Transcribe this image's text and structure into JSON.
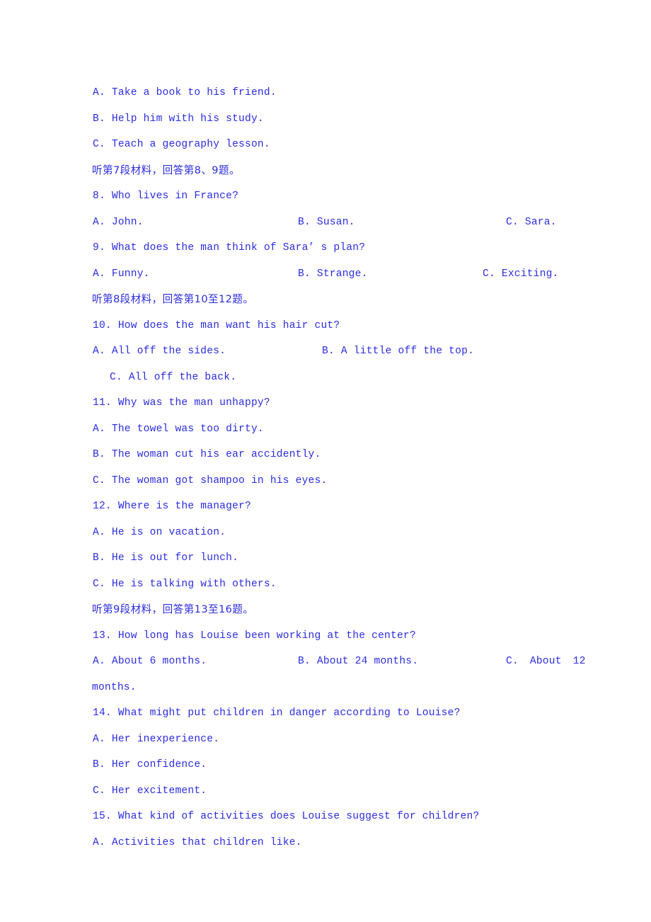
{
  "document": {
    "language_mix": "english-chinese",
    "text_color": "#2b2be0",
    "background_color": "#ffffff"
  },
  "lines": {
    "q7_opt_a": "A. Take a book to his friend.",
    "q7_opt_b": "B. Help him with his study.",
    "q7_opt_c": "C. Teach a geography lesson.",
    "section7_header": "听第7段材料，回答第8、9题。",
    "q8_stem": "8. Who lives in France?",
    "q8_a": "A. John.",
    "q8_b": "B. Susan.",
    "q8_c": "C. Sara.",
    "q9_stem": "9. What does the man think of Sara’ s plan?",
    "q9_a": "A. Funny.",
    "q9_b": "B. Strange.",
    "q9_c": "C. Exciting.",
    "section8_header": "听第8段材料，回答第10至12题。",
    "q10_stem": "10. How does the man want his hair cut?",
    "q10_a": "A. All off the sides.",
    "q10_b": "B. A little off the top.",
    "q10_c": "C. All off the back.",
    "q11_stem": "11. Why was the man unhappy?",
    "q11_a": "A. The towel was too dirty.",
    "q11_b": "B. The woman cut his ear accidently.",
    "q11_c": "C. The woman got shampoo in his eyes.",
    "q12_stem": "12. Where is the manager?",
    "q12_a": "A. He is on vacation.",
    "q12_b": "B. He is out for lunch.",
    "q12_c": "C. He is talking with others.",
    "section9_header": "听第9段材料，回答第13至16题。",
    "q13_stem": "13. How long has Louise been working at the center?",
    "q13_a": "A. About 6 months.",
    "q13_b": "B. About 24 months.",
    "q13_c": "C. About 12",
    "q13_c_wrap": "months.",
    "q14_stem": "14. What might put children in danger according to Louise?",
    "q14_a": "A. Her inexperience.",
    "q14_b": "B. Her confidence.",
    "q14_c": "C. Her excitement.",
    "q15_stem": "15. What kind of activities does Louise suggest for children?",
    "q15_a": "A. Activities that children like."
  }
}
